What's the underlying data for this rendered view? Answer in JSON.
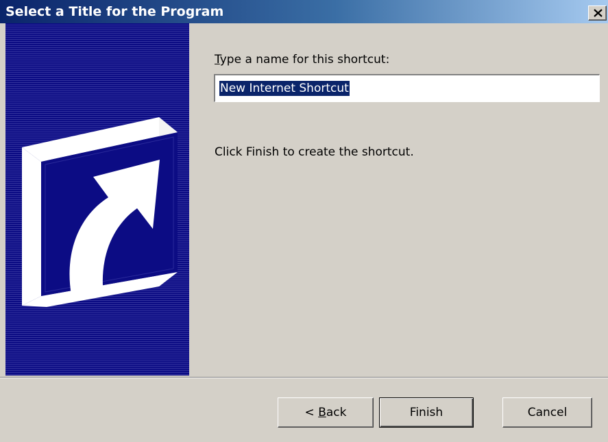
{
  "window": {
    "title": "Select a Title for the Program",
    "close_label": "Close"
  },
  "banner": {
    "icon": "shortcut-arrow-icon"
  },
  "form": {
    "prompt_prefix_underlined": "T",
    "prompt_rest": "ype a name for this shortcut:",
    "name_value": "New Internet Shortcut",
    "hint": "Click Finish to create the shortcut."
  },
  "buttons": {
    "back_prefix": "< ",
    "back_underlined": "B",
    "back_rest": "ack",
    "finish": "Finish",
    "cancel": "Cancel"
  },
  "colors": {
    "titlebar_start": "#0a246a",
    "titlebar_end": "#a6caf0",
    "dialog_face": "#d4d0c8",
    "banner": "#0c0c84",
    "selection": "#0a246a"
  }
}
